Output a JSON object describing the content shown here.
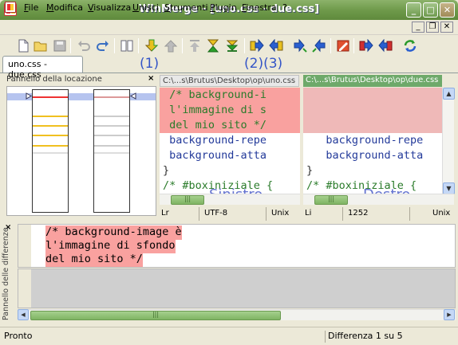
{
  "window": {
    "title": "WinMerge - [uno.css - due.css]",
    "controls": {
      "minimize": "_",
      "maximize": "□",
      "close": "✕"
    }
  },
  "menu": {
    "items": [
      "File",
      "Modifica",
      "Visualizza",
      "Unisci",
      "Strumenti",
      "Plugin",
      "Finestra",
      "?"
    ],
    "mdi_controls": {
      "minimize": "_",
      "restore": "❐",
      "close": "✕"
    }
  },
  "toolbar": {
    "icons": [
      "new-icon",
      "open-icon",
      "save-icon",
      "undo-icon",
      "redo-icon",
      "options-icon",
      "next-diff-icon",
      "prev-diff-icon",
      "first-diff-icon",
      "last-diff-icon",
      "copy-right-icon",
      "copy-left-icon",
      "copy-right-advance-icon",
      "copy-left-advance-icon",
      "copy-all-right-icon",
      "copy-all-left-icon",
      "edit-icon",
      "refresh-icon"
    ]
  },
  "annotations": {
    "a1": "(1)",
    "a23": "(2)(3)"
  },
  "tab": {
    "label": "uno.css - due.css"
  },
  "location_pane": {
    "title": "Pannello della locazione",
    "close": "×"
  },
  "left_pane": {
    "path": "C:\\...s\\Brutus\\Desktop\\op\\uno.css",
    "lines": [
      {
        "text": " /* background-i",
        "diff": true
      },
      {
        "text": " l'immagine di s",
        "diff": true
      },
      {
        "text": " del mio sito */",
        "diff": true
      },
      {
        "text": " background-repe",
        "diff": false
      },
      {
        "text": " background-atta",
        "diff": false
      },
      {
        "text": "}",
        "diff": false
      },
      {
        "text": "/* #boxiniziale {",
        "diff": false
      }
    ],
    "label": "Sinistro",
    "status": {
      "line": "Lr",
      "encoding": "UTF-8",
      "eol": "Unix"
    }
  },
  "right_pane": {
    "path": "C:\\...s\\Brutus\\Desktop\\op\\due.css",
    "lines": [
      {
        "text": "",
        "diff": true
      },
      {
        "text": "",
        "diff": true
      },
      {
        "text": "",
        "diff": true
      },
      {
        "text": "   background-repe",
        "diff": false
      },
      {
        "text": "   background-atta",
        "diff": false
      },
      {
        "text": "}",
        "diff": false
      },
      {
        "text": "/* #boxiniziale {",
        "diff": false
      }
    ],
    "label": "Destro",
    "status": {
      "line": "Li",
      "encoding": "1252",
      "eol": "Unix"
    }
  },
  "diff_pane": {
    "title": "Pannello delle differenze",
    "close": "×",
    "lines": [
      "/* background-image è",
      "l'immagine di sfondo",
      "del mio sito */"
    ]
  },
  "statusbar": {
    "left": "Pronto",
    "right": "Differenza 1 su 5"
  },
  "colors": {
    "diff_left": "#f9a19f",
    "diff_right": "#efb9b8",
    "title_green": "#6f9a4b",
    "accent_blue": "#3455c7"
  }
}
